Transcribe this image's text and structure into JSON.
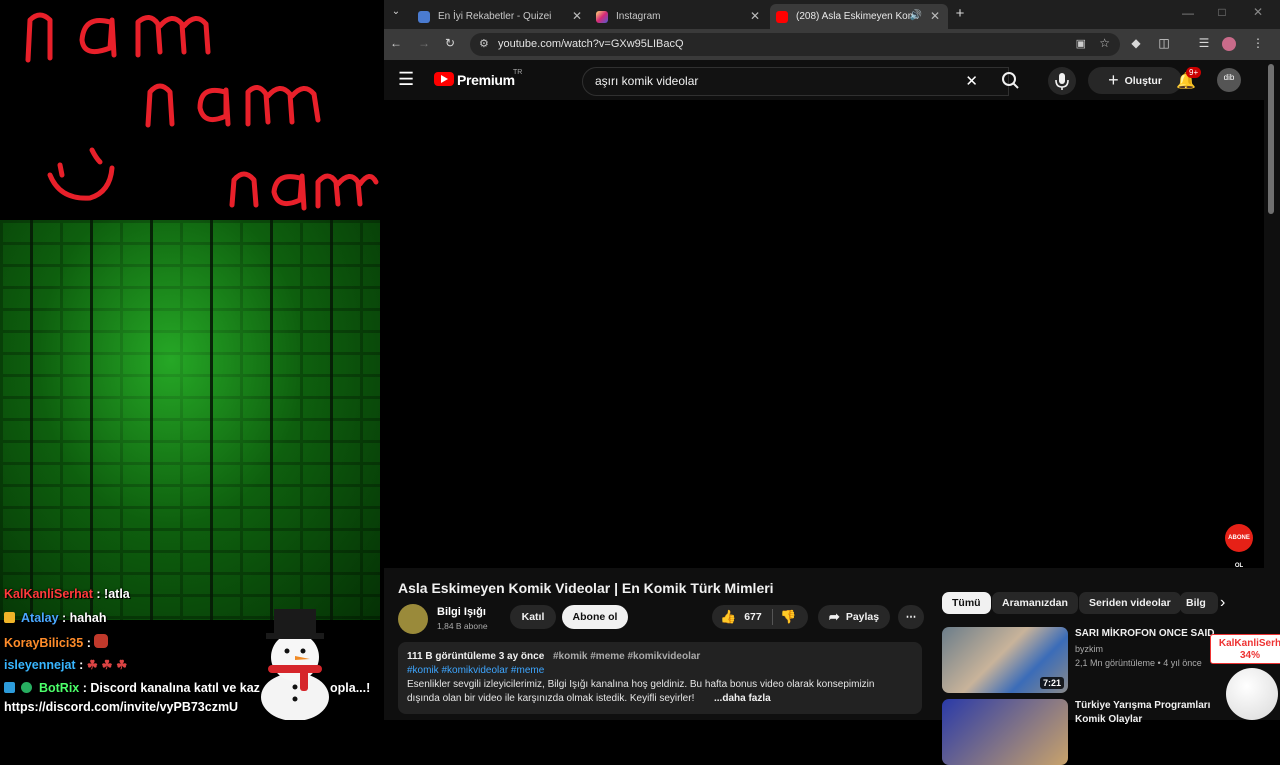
{
  "overlay": {
    "doodle_words": [
      "nam",
      "nam",
      "nam"
    ],
    "chat": [
      {
        "user": "KalKanliSerhat",
        "message": ": !atla"
      },
      {
        "user": "Atalay",
        "message": ": hahah"
      },
      {
        "user": "KorayBilici35",
        "message": ":"
      },
      {
        "user": "isleyennejat",
        "message": ":"
      },
      {
        "user": "BotRix",
        "message": ": Discord kanalına katıl ve kaz",
        "trail": "opla...!"
      },
      {
        "user": "",
        "message": "https://discord.com/invite/vyPB73czmU"
      }
    ]
  },
  "browser": {
    "tabs": [
      {
        "title": "En İyi Rekabetler - Quizei",
        "favicon_color": "#4a7bd0"
      },
      {
        "title": "Instagram",
        "favicon_color": "#d6249f"
      },
      {
        "title": "(208) Asla Eskimeyen Komi",
        "favicon_color": "#ff0000"
      }
    ],
    "url": "youtube.com/watch?v=GXw95LIBacQ"
  },
  "youtube": {
    "logo_text": "Premium",
    "logo_sup": "TR",
    "search_value": "aşırı komik videolar",
    "create_label": "Oluştur",
    "notif_count": "9+",
    "avatar_text": "dib",
    "subscribe_watermark": "ABONE OL",
    "video": {
      "title": "Asla Eskimeyen Komik Videolar | En Komik Türk Mimleri",
      "channel": "Bilgi Işığı",
      "subscribers": "1,84 B abone",
      "join_label": "Katıl",
      "subscribe_label": "Abone ol",
      "likes": "677",
      "share_label": "Paylaş",
      "views_date": "111 B görüntüleme  3 ay önce",
      "hashtags_top": "#komik #meme #komikvideolar",
      "hashtags_line": "#komik #komikvideolar #meme",
      "desc_line1": "Esenlikler sevgili izleyicilerimiz, Bilgi Işığı kanalına hoş geldiniz. Bu hafta bonus video olarak konsepimizin",
      "desc_line2": "dışında olan bir video ile karşınızda olmak istedik. Keyifli seyirler!",
      "more_label": "...daha fazla"
    },
    "chips": [
      "Tümü",
      "Aramanızdan",
      "Seriden videolar",
      "Bilg"
    ],
    "related": [
      {
        "title": "SARI MİKROFON ONCE SAID",
        "channel": "byzkim",
        "meta": "2,1 Mn görüntüleme • 4 yıl önce",
        "duration": "7:21"
      },
      {
        "title": "Türkiye Yarışma Programları",
        "title2": "Komik Olaylar"
      }
    ],
    "donation": {
      "name": "KalKanliSerh",
      "percent": "34%"
    }
  },
  "colors": {
    "yt_red": "#ff0000",
    "bg": "#0f0f0f",
    "brick": "#1fb01f"
  }
}
